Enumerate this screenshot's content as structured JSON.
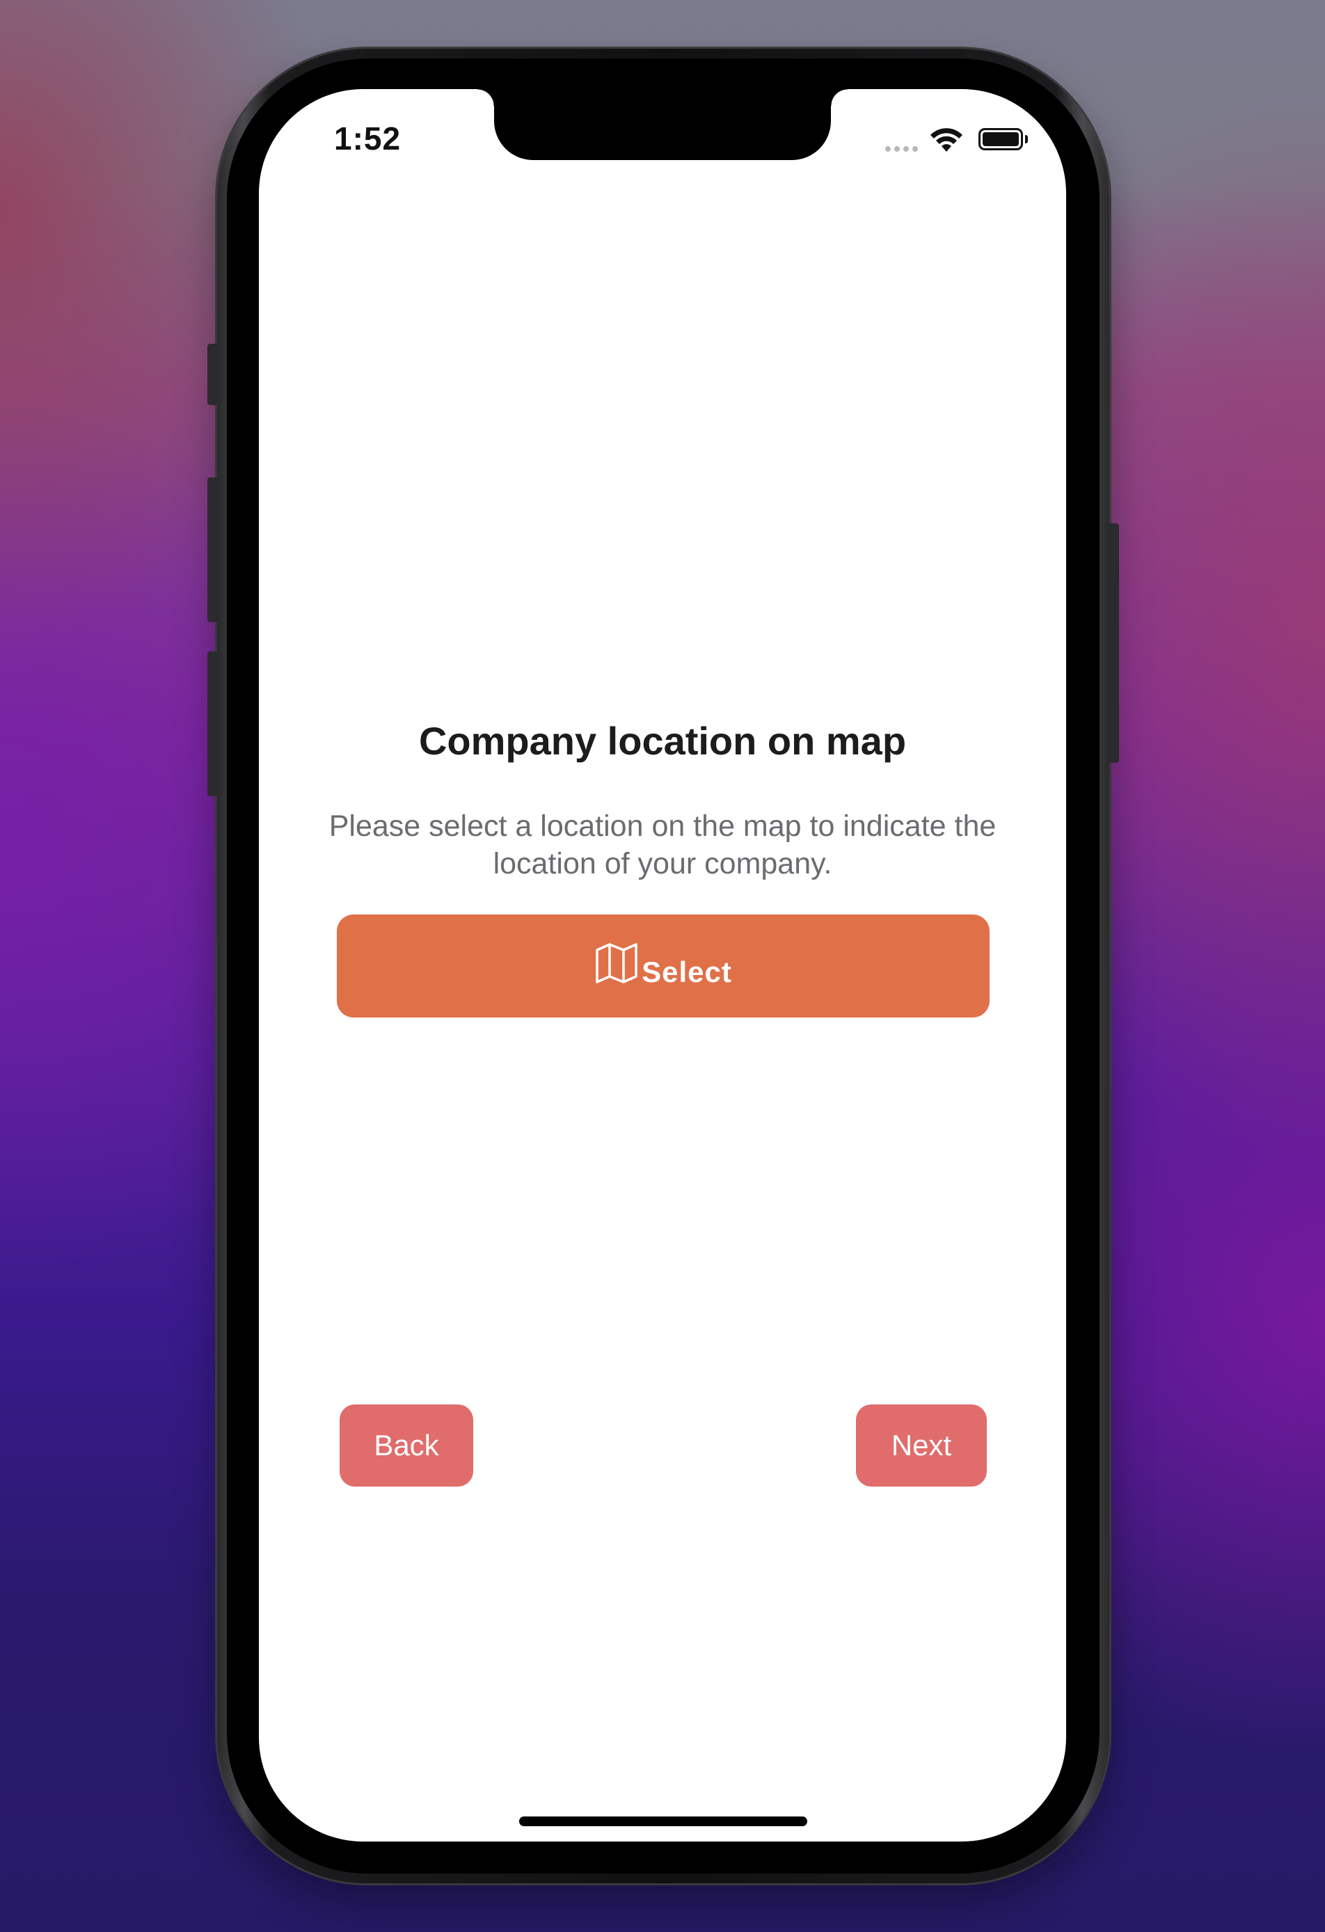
{
  "status_bar": {
    "time": "1:52",
    "icons": [
      "signal-dots-icon",
      "wifi-icon",
      "battery-icon"
    ]
  },
  "content": {
    "title": "Company location on map",
    "description": "Please select a location on the map to indicate the location of your company.",
    "select_button": {
      "icon": "map-icon",
      "label": "Select"
    }
  },
  "navigation": {
    "back_label": "Back",
    "next_label": "Next"
  },
  "colors": {
    "select_button": "#e07048",
    "nav_buttons": "#e06c6c",
    "title_text": "#1c1c1e",
    "description_text": "#6b6b70",
    "screen_background": "#ffffff"
  }
}
